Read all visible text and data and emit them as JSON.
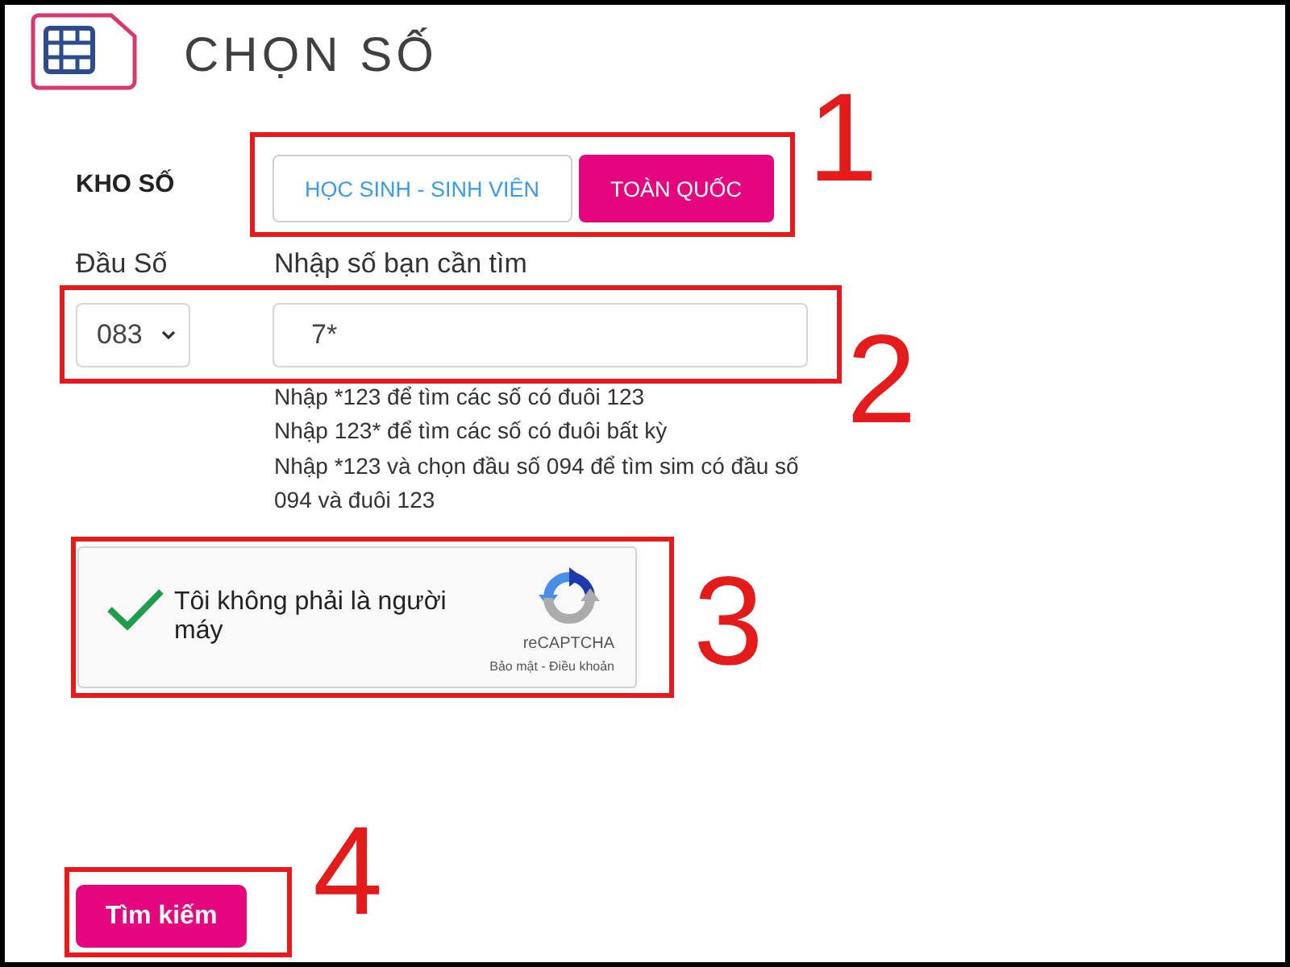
{
  "header": {
    "title": "CHỌN SỐ"
  },
  "number_store": {
    "label": "KHO SỐ",
    "tabs": [
      {
        "label": "HỌC SINH - SINH VIÊN",
        "selected": false
      },
      {
        "label": "TOÀN QUỐC",
        "selected": true
      }
    ]
  },
  "prefix": {
    "label": "Đầu Số",
    "value": "083"
  },
  "search": {
    "label": "Nhập số bạn cần tìm",
    "value": "7*"
  },
  "hints": [
    "Nhập *123 để tìm các số có đuôi 123",
    "Nhập 123* để tìm các số có đuôi bất kỳ",
    "Nhập *123 và chọn đầu số 094 để tìm sim có đầu số 094 và đuôi 123"
  ],
  "captcha": {
    "label": "Tôi không phải là người máy",
    "checked": true,
    "brand": "reCAPTCHA",
    "footer": "Bảo mật - Điều khoản"
  },
  "search_button": {
    "label": "Tìm kiếm"
  },
  "annotations": [
    {
      "label": "1"
    },
    {
      "label": "2"
    },
    {
      "label": "3"
    },
    {
      "label": "4"
    }
  ]
}
